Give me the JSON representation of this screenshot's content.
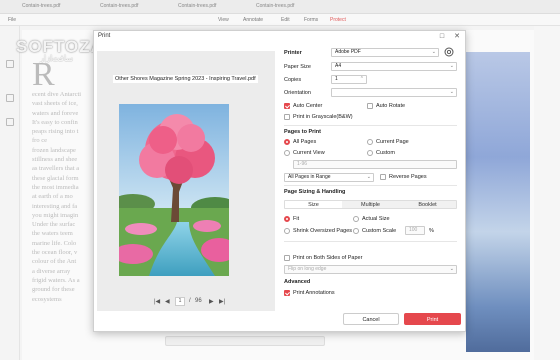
{
  "bg_tabs": [
    "Contain-trees.pdf",
    "Contain-trees.pdf",
    "Contain-trees.pdf",
    "Contain-trees.pdf"
  ],
  "bg_toolbar": [
    "File",
    "View",
    "Annotate",
    "Edit",
    "Forms",
    "Protect"
  ],
  "bg_doc_dropcap": "R",
  "bg_doc_lines": [
    "ecent dive Antarcti",
    "vast sheets of ice,",
    "waters and foreve",
    "It's easy to confin",
    "peaps rising into t",
    "fro ce",
    "frozen landscape",
    "stillness and shee",
    "as travellers that a",
    "these glacial form",
    "the most immedia",
    "at earth of a mo",
    "interesting and fa",
    "you might imagin",
    "",
    "Under the surfac",
    "the waters teem",
    "marine life. Colo",
    "the ocean floor, v",
    "colour of the Ant",
    "a diverse array",
    "frigid waters. As a",
    "ground for these",
    "ecosystems"
  ],
  "watermark": "SOFTOZAR.COM",
  "watermark_sub": "سافت‌ازار",
  "dialog": {
    "title": "Print",
    "minimize": "□",
    "close": "✕"
  },
  "preview": {
    "file_label": "Other Shores Magazine Spring 2023 - Inspiring Travel.pdf",
    "current_page": "1",
    "separator": "/",
    "total_pages": "96",
    "first": "|◀",
    "prev": "◀",
    "next": "▶",
    "last": "▶|"
  },
  "printer": {
    "label": "Printer",
    "value": "Adobe PDF"
  },
  "paper_size": {
    "label": "Paper Size",
    "value": "A4"
  },
  "copies": {
    "label": "Copies",
    "value": "1"
  },
  "orientation": {
    "label": "Orientation",
    "value": ""
  },
  "auto_center": {
    "label": "Auto Center",
    "checked": true
  },
  "auto_rotate": {
    "label": "Auto Rotate",
    "checked": false
  },
  "grayscale": {
    "label": "Print in Grayscale(B&W)",
    "checked": false
  },
  "pages_section": "Pages to Print",
  "all_pages": "All Pages",
  "current_page_opt": "Current Page",
  "current_view": "Current View",
  "custom": "Custom",
  "custom_value": "1-96",
  "range_select": "All Pages in Range",
  "reverse_pages": "Reverse Pages",
  "sizing_section": "Page Sizing & Handling",
  "sizing_tabs": [
    "Size",
    "Multiple",
    "Booklet"
  ],
  "fit": "Fit",
  "actual_size": "Actual Size",
  "shrink": "Shrink Oversized Pages",
  "custom_scale": "Custom Scale",
  "scale_value": "100",
  "scale_unit": "%",
  "both_sides": "Print on Both Sides of Paper",
  "flip_select": "Flip on long edge",
  "advanced_section": "Advanced",
  "print_annotations": "Print Annotations",
  "cancel": "Cancel",
  "print": "Print",
  "colors": {
    "accent": "#e5484d"
  },
  "icons": [
    "gear-icon",
    "chevron-down-icon",
    "square-icon",
    "close-icon"
  ]
}
